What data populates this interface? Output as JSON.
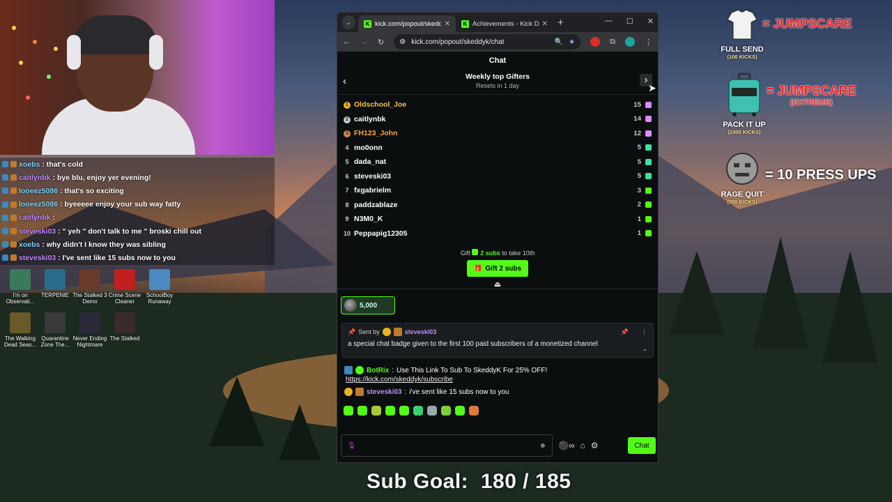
{
  "overlay_chat": [
    {
      "user": "xoebs",
      "text": ": that's cold",
      "color": "#7ed4ff"
    },
    {
      "user": "caitlynbk",
      "text": ": bye blu, enjoy yer evening!",
      "color": "#c18cff"
    },
    {
      "user": "looeez5086",
      "text": ": that's so exciting",
      "color": "#7ed4ff"
    },
    {
      "user": "looeez5086",
      "text": ": byeeeee enjoy your sub way fatty",
      "color": "#7ed4ff"
    },
    {
      "user": "caitlynbk",
      "text": ":",
      "color": "#c18cff"
    },
    {
      "user": "steveski03",
      "text": ": \" yeh \" don't talk to me \" broski chill out",
      "color": "#c18cff"
    },
    {
      "user": "xoebs",
      "text": ": why didn't I know they was sibling",
      "color": "#7ed4ff"
    },
    {
      "user": "steveski03",
      "text": ": I've sent like 15 subs now to you",
      "color": "#c18cff"
    }
  ],
  "desktop_icons": [
    {
      "label": "I'm on Observati...",
      "color": "#3a7a5a"
    },
    {
      "label": "TERPENIE",
      "color": "#2a6a8a"
    },
    {
      "label": "The Stalked 3 Demo",
      "color": "#6a3a2a"
    },
    {
      "label": "Crime Scene Cleaner",
      "color": "#c02020"
    },
    {
      "label": "SchoolBoy Runaway",
      "color": "#4a8ac0"
    },
    {
      "label": "The Walking Dead Seas...",
      "color": "#6a5a2a"
    },
    {
      "label": "Quarantine Zone The...",
      "color": "#3a3a3a"
    },
    {
      "label": "Never Ending Nightmare",
      "color": "#2a2a3a"
    },
    {
      "label": "The Stalked",
      "color": "#3a2a2a"
    }
  ],
  "browser": {
    "tabs": [
      {
        "title": "kick.com/popout/skeddyk/c",
        "active": true
      },
      {
        "title": "Achievements - Kick Dashb",
        "active": false
      }
    ],
    "url": "kick.com/popout/skeddyk/chat"
  },
  "chat": {
    "title": "Chat",
    "gifters": {
      "title": "Weekly top Gifters",
      "subtitle": "Resets in 1 day",
      "rows": [
        {
          "rank": "1",
          "name": "Oldschool_Joe",
          "count": "15",
          "medal": "#e8b421",
          "name_color": "#f5c242",
          "gift_color": "#d98cff"
        },
        {
          "rank": "2",
          "name": "caitlynbk",
          "count": "14",
          "medal": "#c8c8c8",
          "name_color": "#ffffff",
          "gift_color": "#d98cff"
        },
        {
          "rank": "3",
          "name": "FH123_John",
          "count": "12",
          "medal": "#d0894a",
          "name_color": "#f5a742",
          "gift_color": "#d98cff"
        },
        {
          "rank": "4",
          "name": "mo0onn",
          "count": "5",
          "medal": "",
          "name_color": "#ffffff",
          "gift_color": "#3ee0a0"
        },
        {
          "rank": "5",
          "name": "dada_nat",
          "count": "5",
          "medal": "",
          "name_color": "#ffffff",
          "gift_color": "#3ee0a0"
        },
        {
          "rank": "6",
          "name": "steveski03",
          "count": "5",
          "medal": "",
          "name_color": "#ffffff",
          "gift_color": "#3ee0a0"
        },
        {
          "rank": "7",
          "name": "fxgabrielm",
          "count": "3",
          "medal": "",
          "name_color": "#ffffff",
          "gift_color": "#53fc18"
        },
        {
          "rank": "8",
          "name": "paddzablaze",
          "count": "2",
          "medal": "",
          "name_color": "#ffffff",
          "gift_color": "#53fc18"
        },
        {
          "rank": "9",
          "name": "N3M0_K",
          "count": "1",
          "medal": "",
          "name_color": "#ffffff",
          "gift_color": "#53fc18"
        },
        {
          "rank": "10",
          "name": "Peppapig12305",
          "count": "1",
          "medal": "",
          "name_color": "#ffffff",
          "gift_color": "#53fc18"
        }
      ],
      "cta_prefix": "Gift",
      "cta_highlight": "2 subs",
      "cta_suffix": "to take 10th",
      "button_label": "Gift 2 subs"
    },
    "kicks_value": "5,000",
    "pinned": {
      "sent_by_label": "Sent by",
      "user": "steveski03",
      "message": "a special chat badge given to the first 100 paid subscribers of a monetized channel"
    },
    "messages": [
      {
        "user": "BotRix",
        "text": "Use This Link To Sub To SkeddyK For 25% OFF!",
        "link": "https://kick.com/skeddyk/subscribe"
      },
      {
        "user": "steveski03",
        "text": "i've sent like 15 subs now to you",
        "link": ""
      }
    ],
    "input_placeholder": "",
    "send_label": "Chat"
  },
  "stream_goals": [
    {
      "label": "FULL SEND",
      "sub": "(100 KICKS)",
      "reward": "= JUMPSCARE",
      "reward_sub": ""
    },
    {
      "label": "PACK IT UP",
      "sub": "(1000 KICKS)",
      "reward": "= JUMPSCARE",
      "reward_sub": "(EXTREME)"
    },
    {
      "label": "RAGE QUIT",
      "sub": "(500 KICKS)",
      "reward": "= 10 PRESS UPS",
      "reward_sub": ""
    }
  ],
  "sub_goal": {
    "label": "Sub Goal:",
    "value": "180 / 185",
    "current": 180,
    "target": 185
  },
  "colors": {
    "kick_green": "#53fc18",
    "jumpscare_red": "#ff2020"
  }
}
